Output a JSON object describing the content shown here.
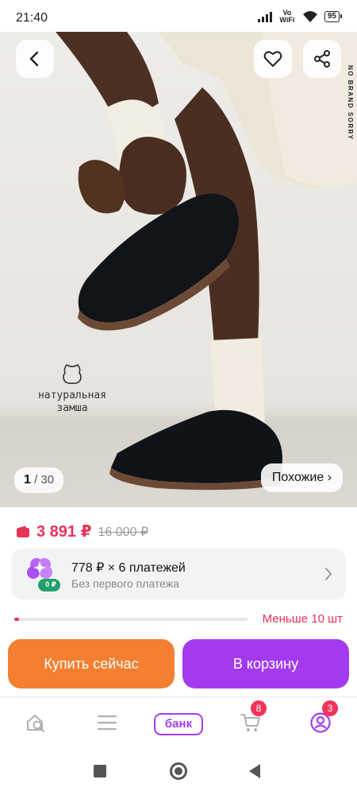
{
  "status_bar": {
    "time": "21:40",
    "network_label": "Vo WiFi",
    "battery": "95",
    "icons": [
      "signal-icon",
      "wifi-icon",
      "battery-icon"
    ]
  },
  "product": {
    "brand_vertical": "NO BRAND SORRY",
    "badge_line1": "натуральная",
    "badge_line2": "замша",
    "image_counter_current": "1",
    "image_counter_total": "/ 30",
    "similar_label": "Похожие ›"
  },
  "price": {
    "current": "3 891 ₽",
    "old": "16 000 ₽"
  },
  "installments": {
    "title": "778 ₽ × 6 платежей",
    "subtitle": "Без первого платежа",
    "badge": "0 ₽"
  },
  "stock": {
    "label": "Меньше 10 шт",
    "level": 0.02
  },
  "actions": {
    "buy_now": "Купить сейчас",
    "add_to_cart": "В корзину"
  },
  "bottom_nav": {
    "bank_label": "банк",
    "cart_badge": "8",
    "profile_badge": "3"
  },
  "colors": {
    "accent_purple": "#a43af0",
    "buy_orange": "#f57f31",
    "price_red": "#e8335a",
    "badge_green": "#22a06b"
  }
}
